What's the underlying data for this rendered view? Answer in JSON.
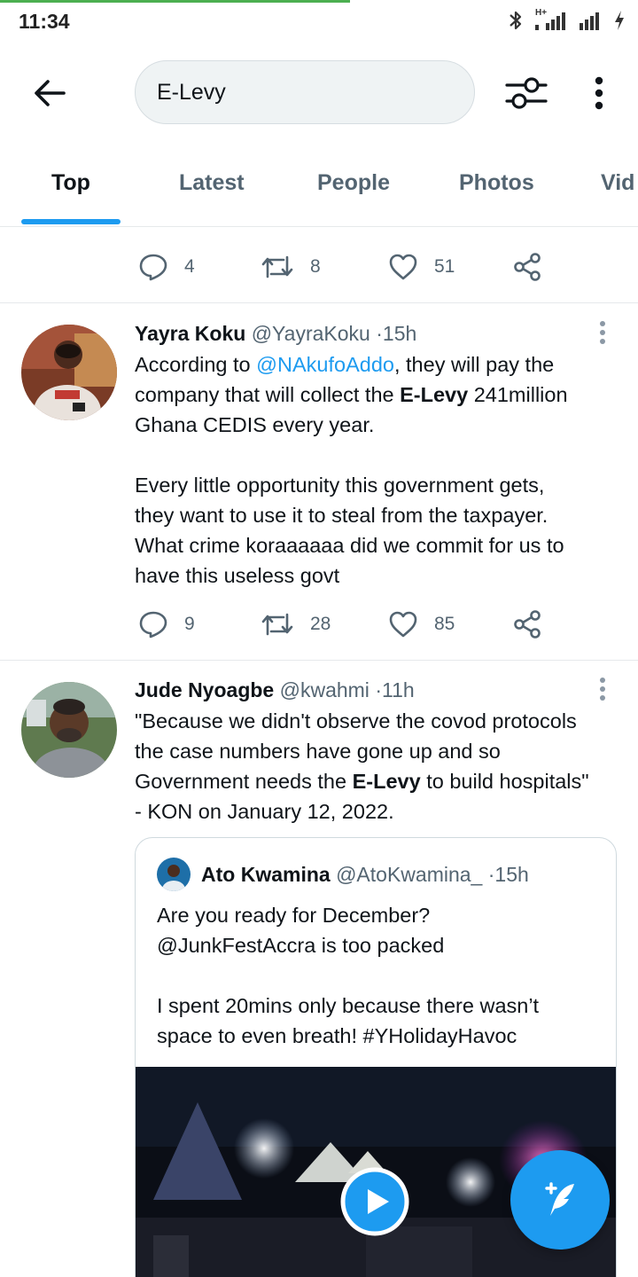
{
  "status_bar": {
    "time": "11:34",
    "network_label": "H+",
    "icons": [
      "bluetooth-icon",
      "signal-icon",
      "signal-icon",
      "charging-icon"
    ]
  },
  "search": {
    "query": "E-Levy",
    "back_icon": "arrow-left-icon",
    "filter_icon": "sliders-icon",
    "more_icon": "more-vertical-icon"
  },
  "tabs": [
    {
      "label": "Top",
      "active": true
    },
    {
      "label": "Latest",
      "active": false
    },
    {
      "label": "People",
      "active": false
    },
    {
      "label": "Photos",
      "active": false
    },
    {
      "label": "Vid",
      "active": false
    }
  ],
  "colors": {
    "accent": "#1d9bf0",
    "text_primary": "#0f1419",
    "text_secondary": "#536471",
    "divider": "#e6e9eb",
    "loading_bar": "#4caf50"
  },
  "previous_tweet": {
    "replies": "4",
    "retweets": "8",
    "likes": "51"
  },
  "tweets": [
    {
      "name": "Yayra Koku",
      "handle": "@YayraKoku",
      "separator": "·",
      "time": "15h",
      "text_lines": [
        {
          "before": "According to ",
          "mention": "@NAkufoAddo",
          "after": ", they will pay the"
        },
        {
          "before": "company that will collect the ",
          "bold": "E-Levy",
          "after": " 241million"
        },
        {
          "text": "Ghana CEDIS every year."
        },
        {
          "text": "Every little opportunity this government gets,"
        },
        {
          "text": "they want to use it to steal from the taxpayer."
        },
        {
          "text": "What crime koraaaaaa did we commit for us to"
        },
        {
          "text": "have this useless govt"
        }
      ],
      "replies": "9",
      "retweets": "28",
      "likes": "85"
    },
    {
      "name": "Jude Nyoagbe",
      "handle": "@kwahmi",
      "separator": "·",
      "time": "11h",
      "text_lines": [
        {
          "text": "\"Because we didn't observe the covod protocols"
        },
        {
          "text": "the case numbers have gone up and so"
        },
        {
          "before": "Government needs the ",
          "bold": "E-Levy",
          "after": " to build hospitals\""
        },
        {
          "text": "- KON on January 12, 2022."
        }
      ],
      "quote": {
        "name": "Ato Kwamina",
        "handle": "@AtoKwamina_",
        "separator": "·",
        "time": "15h",
        "text_lines": [
          "Are you ready for December?",
          "@JunkFestAccra is too packed",
          "I spent 20mins only because there wasn’t",
          "space to even breath! #YHolidayHavoc"
        ],
        "media_icon": "play-icon"
      }
    }
  ],
  "fab": {
    "icon": "compose-tweet-icon"
  }
}
